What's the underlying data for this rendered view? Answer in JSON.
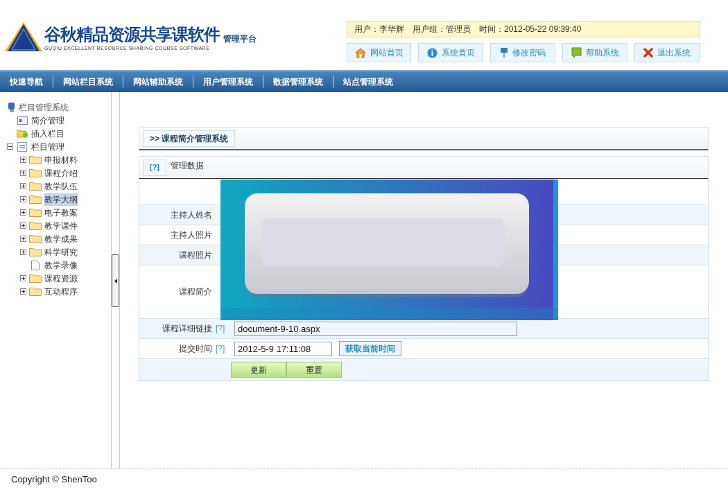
{
  "logo": {
    "title": "谷秋精品资源共享课软件",
    "subtitle": "GUQIU EXCELLENT RESOURCE SHARING COURSE SOFTWARE",
    "tag": "管理平台"
  },
  "user_info": "用户：李华辉　用户组：管理员　时间：2012-05-22 09:39:40",
  "top_buttons": [
    {
      "kind": "home",
      "label": "网站首页"
    },
    {
      "kind": "info",
      "label": "系统首页"
    },
    {
      "kind": "key",
      "label": "修改密码"
    },
    {
      "kind": "help",
      "label": "帮助系统"
    },
    {
      "kind": "exit",
      "label": "退出系统"
    }
  ],
  "nav": [
    "快速导航",
    "网站栏目系统",
    "网站辅助系统",
    "用户管理系统",
    "数据管理系统",
    "站点管理系统"
  ],
  "tree": {
    "label": "栏目管理系统",
    "children": [
      {
        "kind": "card",
        "label": "简介管理",
        "selected": false
      },
      {
        "kind": "add",
        "label": "插入栏目",
        "selected": false
      },
      {
        "kind": "list",
        "label": "栏目管理",
        "selected": false,
        "expanded": true,
        "children": [
          {
            "kind": "folder",
            "label": "申报材料",
            "selected": false,
            "expanded": false
          },
          {
            "kind": "folder",
            "label": "课程介绍",
            "selected": false,
            "expanded": false
          },
          {
            "kind": "folder",
            "label": "教学队伍",
            "selected": false,
            "expanded": false
          },
          {
            "kind": "folder",
            "label": "教学大纲",
            "selected": true,
            "expanded": false
          },
          {
            "kind": "folder",
            "label": "电子教案",
            "selected": false,
            "expanded": false
          },
          {
            "kind": "folder",
            "label": "教学课件",
            "selected": false,
            "expanded": false
          },
          {
            "kind": "folder",
            "label": "教学成果",
            "selected": false,
            "expanded": false
          },
          {
            "kind": "folder",
            "label": "科学研究",
            "selected": false,
            "expanded": false
          },
          {
            "kind": "page",
            "label": "教学录像",
            "selected": false
          },
          {
            "kind": "folder",
            "label": "课程资源",
            "selected": false,
            "expanded": false
          },
          {
            "kind": "folder",
            "label": "互动程序",
            "selected": false,
            "expanded": false
          }
        ]
      }
    ]
  },
  "breadcrumb": ">> 课程简介管理系统",
  "panel": {
    "help": "[?]",
    "title": "管理数据"
  },
  "form": {
    "rows": [
      {
        "kind": "blank"
      },
      {
        "kind": "text",
        "label": "主持人姓名"
      },
      {
        "kind": "text",
        "label": "主持人照片"
      },
      {
        "kind": "text",
        "label": "课程照片"
      },
      {
        "kind": "tall",
        "label": "课程简介"
      },
      {
        "kind": "input",
        "label": "课程详细链接",
        "help": "[?]",
        "value": "document-9-10.aspx"
      },
      {
        "kind": "time",
        "label": "提交时间",
        "help": "[?]",
        "value": "2012-5-9 17:11:08",
        "button": "获取当前时间"
      }
    ],
    "buttons": [
      "更新",
      "重置"
    ],
    "overlay": {
      "kind": "picture"
    }
  },
  "footer": "Copyright © ShenToo"
}
